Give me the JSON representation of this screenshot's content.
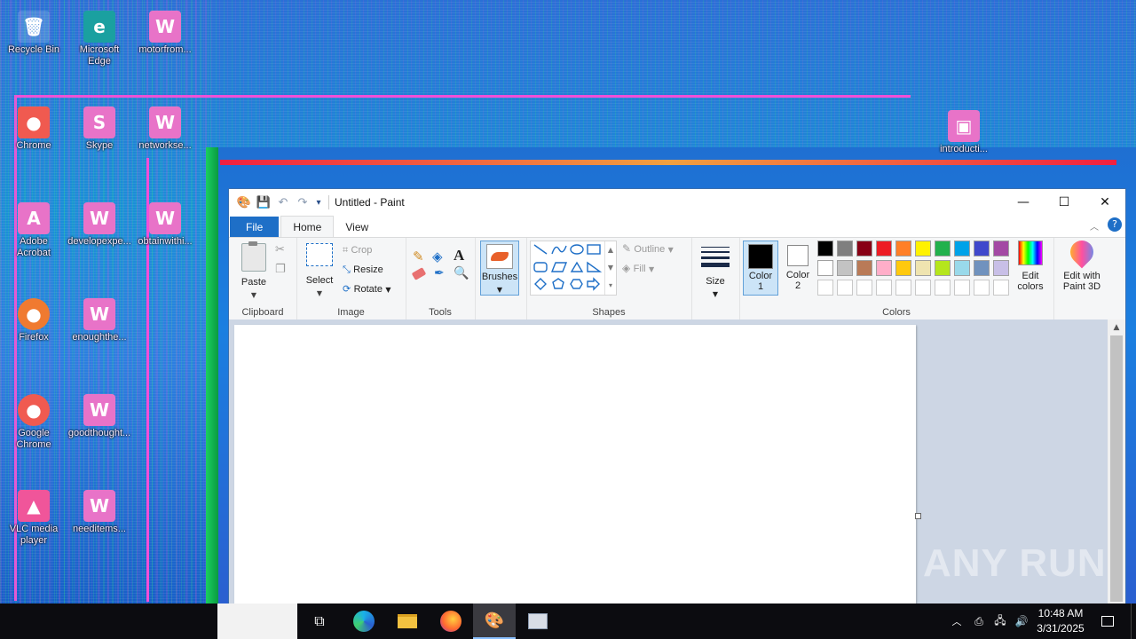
{
  "desktop": {
    "icons": [
      {
        "label": "Recycle Bin",
        "glyph": "🗑"
      },
      {
        "label": "Microsoft Edge",
        "glyph": "e"
      },
      {
        "label": "motorfrom...",
        "glyph": "W"
      },
      {
        "label": "Chrome",
        "glyph": "●"
      },
      {
        "label": "Skype",
        "glyph": "S"
      },
      {
        "label": "networkse...",
        "glyph": "W"
      },
      {
        "label": "Adobe Acrobat",
        "glyph": "A"
      },
      {
        "label": "developexpe...",
        "glyph": "W"
      },
      {
        "label": "obtainwithi...",
        "glyph": "W"
      },
      {
        "label": "Firefox",
        "glyph": "●"
      },
      {
        "label": "enoughthe...",
        "glyph": "W"
      },
      {
        "label": "Google Chrome",
        "glyph": "●"
      },
      {
        "label": "goodthought...",
        "glyph": "W"
      },
      {
        "label": "VLC media player",
        "glyph": "▲"
      },
      {
        "label": "needitems...",
        "glyph": "W"
      },
      {
        "label": "introducti...",
        "glyph": "▣"
      }
    ]
  },
  "paint": {
    "title": "Untitled - Paint",
    "quick_access": {
      "app_icon": "paint-palette-icon",
      "save": "save-icon",
      "undo": "undo-icon",
      "redo": "redo-icon",
      "customize": "chevron-down-icon"
    },
    "window_buttons": {
      "minimize": "—",
      "maximize": "☐",
      "close": "✕"
    },
    "tabs": [
      "File",
      "Home",
      "View"
    ],
    "ribbon": {
      "clipboard": {
        "paste": "Paste",
        "group": "Clipboard"
      },
      "image": {
        "select": "Select",
        "crop": "Crop",
        "resize": "Resize",
        "rotate": "Rotate",
        "group": "Image"
      },
      "tools": {
        "group": "Tools"
      },
      "brushes": {
        "label": "Brushes"
      },
      "shapes": {
        "outline": "Outline",
        "fill": "Fill",
        "group": "Shapes"
      },
      "size": {
        "label": "Size"
      },
      "colors": {
        "color1_label": "Color 1",
        "color1_line1": "Color",
        "color1_line2": "1",
        "color2_line1": "Color",
        "color2_line2": "2",
        "color1_value": "#000000",
        "color2_value": "#ffffff",
        "edit_line1": "Edit",
        "edit_line2": "colors",
        "paint3d_line1": "Edit with",
        "paint3d_line2": "Paint 3D",
        "group": "Colors",
        "palette_row1": [
          "#000000",
          "#7f7f7f",
          "#880015",
          "#ed1c24",
          "#ff7f27",
          "#fff200",
          "#22b14c",
          "#00a2e8",
          "#3f48cc",
          "#a349a4"
        ],
        "palette_row2": [
          "#ffffff",
          "#c3c3c3",
          "#b97a57",
          "#ffaec9",
          "#ffc90e",
          "#efe4b0",
          "#b5e61d",
          "#99d9ea",
          "#7092be",
          "#c8bfe7"
        ],
        "palette_row3": [
          "#ffffff",
          "#ffffff",
          "#ffffff",
          "#ffffff",
          "#ffffff",
          "#ffffff",
          "#ffffff",
          "#ffffff",
          "#ffffff",
          "#ffffff"
        ]
      }
    }
  },
  "taskbar": {
    "time": "10:48 AM",
    "date": "3/31/2025",
    "apps": [
      "task-view-icon",
      "edge-icon",
      "file-explorer-icon",
      "firefox-icon",
      "paint-icon",
      "window-app-icon"
    ]
  },
  "watermark": "ANY RUN"
}
